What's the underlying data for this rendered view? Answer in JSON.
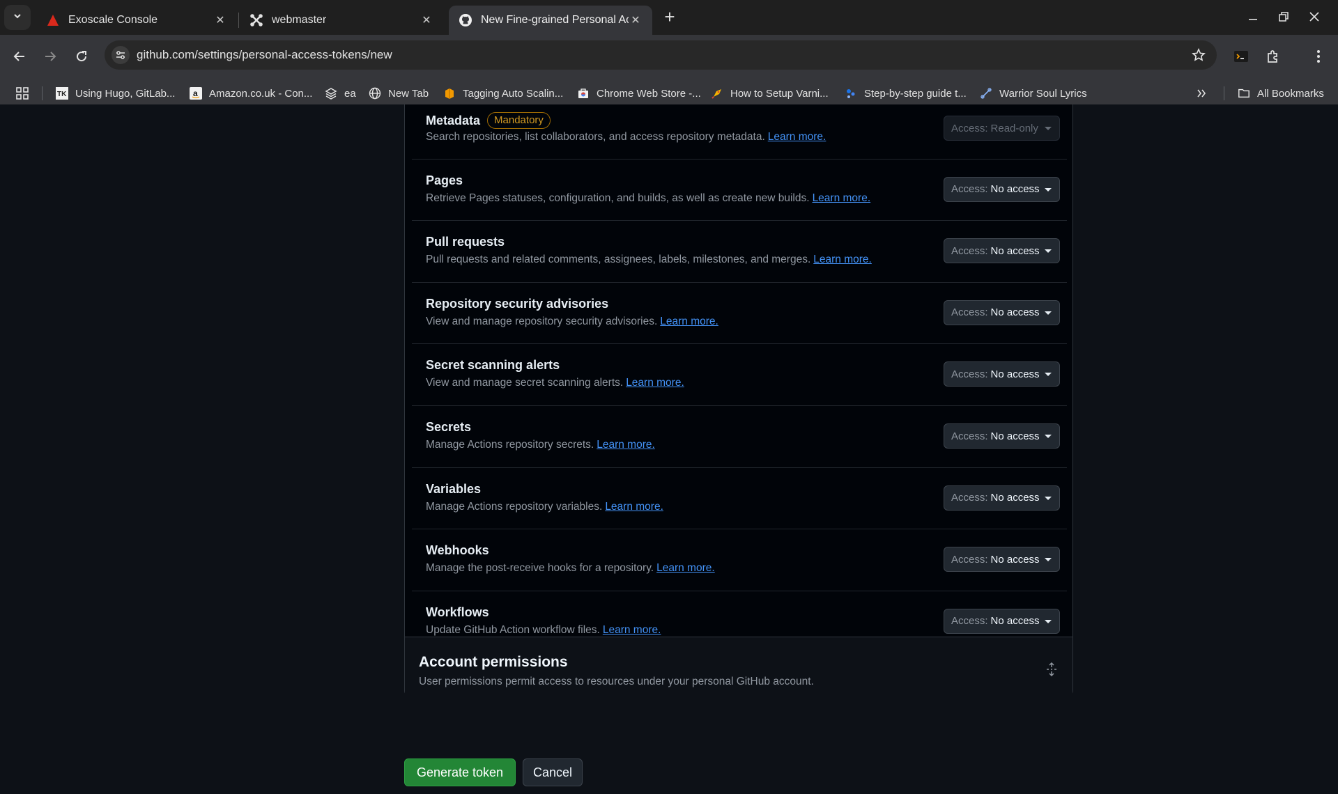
{
  "browser": {
    "tabs": [
      {
        "title": "Exoscale Console",
        "active": false
      },
      {
        "title": "webmaster",
        "active": false
      },
      {
        "title": "New Fine-grained Personal Acc",
        "active": true
      }
    ],
    "url": "github.com/settings/personal-access-tokens/new",
    "bookmarks": [
      {
        "label": "Using Hugo, GitLab...",
        "icon": "tk-icon"
      },
      {
        "label": "Amazon.co.uk - Con...",
        "icon": "amazon-icon"
      },
      {
        "label": "ea",
        "icon": "stack-icon"
      },
      {
        "label": "New Tab",
        "icon": "globe-icon"
      },
      {
        "label": "Tagging Auto Scalin...",
        "icon": "aws-icon"
      },
      {
        "label": "Chrome Web Store -...",
        "icon": "chrome-store-icon"
      },
      {
        "label": "How to Setup Varni...",
        "icon": "rocket-icon"
      },
      {
        "label": "Step-by-step guide t...",
        "icon": "dots-icon"
      },
      {
        "label": "Warrior Soul Lyrics",
        "icon": "link-icon"
      }
    ],
    "all_bookmarks_label": "All Bookmarks"
  },
  "permissions": {
    "access_prefix": "Access:",
    "learn_more": "Learn more.",
    "mandatory_label": "Mandatory",
    "rows": [
      {
        "title": "Metadata",
        "mandatory": true,
        "desc": "Search repositories, list collaborators, and access repository metadata.",
        "access": "Read-only",
        "disabled": true
      },
      {
        "title": "Pages",
        "mandatory": false,
        "desc": "Retrieve Pages statuses, configuration, and builds, as well as create new builds.",
        "access": "No access",
        "disabled": false
      },
      {
        "title": "Pull requests",
        "mandatory": false,
        "desc": "Pull requests and related comments, assignees, labels, milestones, and merges.",
        "access": "No access",
        "disabled": false
      },
      {
        "title": "Repository security advisories",
        "mandatory": false,
        "desc": "View and manage repository security advisories.",
        "access": "No access",
        "disabled": false
      },
      {
        "title": "Secret scanning alerts",
        "mandatory": false,
        "desc": "View and manage secret scanning alerts.",
        "access": "No access",
        "disabled": false
      },
      {
        "title": "Secrets",
        "mandatory": false,
        "desc": "Manage Actions repository secrets.",
        "access": "No access",
        "disabled": false
      },
      {
        "title": "Variables",
        "mandatory": false,
        "desc": "Manage Actions repository variables.",
        "access": "No access",
        "disabled": false
      },
      {
        "title": "Webhooks",
        "mandatory": false,
        "desc": "Manage the post-receive hooks for a repository.",
        "access": "No access",
        "disabled": false
      },
      {
        "title": "Workflows",
        "mandatory": false,
        "desc": "Update GitHub Action workflow files.",
        "access": "No access",
        "disabled": false
      }
    ]
  },
  "account_permissions": {
    "title": "Account permissions",
    "desc": "User permissions permit access to resources under your personal GitHub account."
  },
  "actions": {
    "generate_label": "Generate token",
    "cancel_label": "Cancel"
  },
  "colors": {
    "page_bg": "#0d1117",
    "link": "#4493f8",
    "primary_button": "#238636",
    "mandatory": "#d29922"
  }
}
